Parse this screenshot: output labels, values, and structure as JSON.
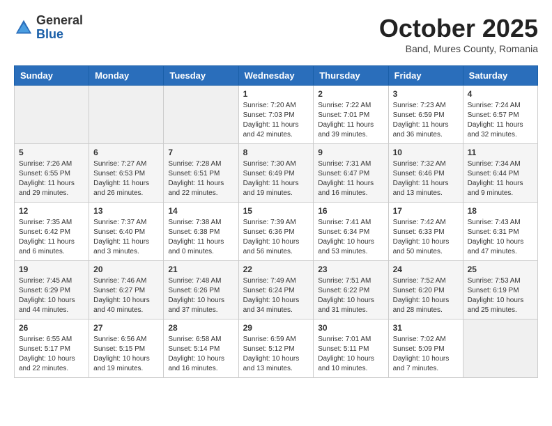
{
  "logo": {
    "general": "General",
    "blue": "Blue"
  },
  "title": "October 2025",
  "subtitle": "Band, Mures County, Romania",
  "days_of_week": [
    "Sunday",
    "Monday",
    "Tuesday",
    "Wednesday",
    "Thursday",
    "Friday",
    "Saturday"
  ],
  "weeks": [
    [
      {
        "day": "",
        "info": ""
      },
      {
        "day": "",
        "info": ""
      },
      {
        "day": "",
        "info": ""
      },
      {
        "day": "1",
        "info": "Sunrise: 7:20 AM\nSunset: 7:03 PM\nDaylight: 11 hours and 42 minutes."
      },
      {
        "day": "2",
        "info": "Sunrise: 7:22 AM\nSunset: 7:01 PM\nDaylight: 11 hours and 39 minutes."
      },
      {
        "day": "3",
        "info": "Sunrise: 7:23 AM\nSunset: 6:59 PM\nDaylight: 11 hours and 36 minutes."
      },
      {
        "day": "4",
        "info": "Sunrise: 7:24 AM\nSunset: 6:57 PM\nDaylight: 11 hours and 32 minutes."
      }
    ],
    [
      {
        "day": "5",
        "info": "Sunrise: 7:26 AM\nSunset: 6:55 PM\nDaylight: 11 hours and 29 minutes."
      },
      {
        "day": "6",
        "info": "Sunrise: 7:27 AM\nSunset: 6:53 PM\nDaylight: 11 hours and 26 minutes."
      },
      {
        "day": "7",
        "info": "Sunrise: 7:28 AM\nSunset: 6:51 PM\nDaylight: 11 hours and 22 minutes."
      },
      {
        "day": "8",
        "info": "Sunrise: 7:30 AM\nSunset: 6:49 PM\nDaylight: 11 hours and 19 minutes."
      },
      {
        "day": "9",
        "info": "Sunrise: 7:31 AM\nSunset: 6:47 PM\nDaylight: 11 hours and 16 minutes."
      },
      {
        "day": "10",
        "info": "Sunrise: 7:32 AM\nSunset: 6:46 PM\nDaylight: 11 hours and 13 minutes."
      },
      {
        "day": "11",
        "info": "Sunrise: 7:34 AM\nSunset: 6:44 PM\nDaylight: 11 hours and 9 minutes."
      }
    ],
    [
      {
        "day": "12",
        "info": "Sunrise: 7:35 AM\nSunset: 6:42 PM\nDaylight: 11 hours and 6 minutes."
      },
      {
        "day": "13",
        "info": "Sunrise: 7:37 AM\nSunset: 6:40 PM\nDaylight: 11 hours and 3 minutes."
      },
      {
        "day": "14",
        "info": "Sunrise: 7:38 AM\nSunset: 6:38 PM\nDaylight: 11 hours and 0 minutes."
      },
      {
        "day": "15",
        "info": "Sunrise: 7:39 AM\nSunset: 6:36 PM\nDaylight: 10 hours and 56 minutes."
      },
      {
        "day": "16",
        "info": "Sunrise: 7:41 AM\nSunset: 6:34 PM\nDaylight: 10 hours and 53 minutes."
      },
      {
        "day": "17",
        "info": "Sunrise: 7:42 AM\nSunset: 6:33 PM\nDaylight: 10 hours and 50 minutes."
      },
      {
        "day": "18",
        "info": "Sunrise: 7:43 AM\nSunset: 6:31 PM\nDaylight: 10 hours and 47 minutes."
      }
    ],
    [
      {
        "day": "19",
        "info": "Sunrise: 7:45 AM\nSunset: 6:29 PM\nDaylight: 10 hours and 44 minutes."
      },
      {
        "day": "20",
        "info": "Sunrise: 7:46 AM\nSunset: 6:27 PM\nDaylight: 10 hours and 40 minutes."
      },
      {
        "day": "21",
        "info": "Sunrise: 7:48 AM\nSunset: 6:26 PM\nDaylight: 10 hours and 37 minutes."
      },
      {
        "day": "22",
        "info": "Sunrise: 7:49 AM\nSunset: 6:24 PM\nDaylight: 10 hours and 34 minutes."
      },
      {
        "day": "23",
        "info": "Sunrise: 7:51 AM\nSunset: 6:22 PM\nDaylight: 10 hours and 31 minutes."
      },
      {
        "day": "24",
        "info": "Sunrise: 7:52 AM\nSunset: 6:20 PM\nDaylight: 10 hours and 28 minutes."
      },
      {
        "day": "25",
        "info": "Sunrise: 7:53 AM\nSunset: 6:19 PM\nDaylight: 10 hours and 25 minutes."
      }
    ],
    [
      {
        "day": "26",
        "info": "Sunrise: 6:55 AM\nSunset: 5:17 PM\nDaylight: 10 hours and 22 minutes."
      },
      {
        "day": "27",
        "info": "Sunrise: 6:56 AM\nSunset: 5:15 PM\nDaylight: 10 hours and 19 minutes."
      },
      {
        "day": "28",
        "info": "Sunrise: 6:58 AM\nSunset: 5:14 PM\nDaylight: 10 hours and 16 minutes."
      },
      {
        "day": "29",
        "info": "Sunrise: 6:59 AM\nSunset: 5:12 PM\nDaylight: 10 hours and 13 minutes."
      },
      {
        "day": "30",
        "info": "Sunrise: 7:01 AM\nSunset: 5:11 PM\nDaylight: 10 hours and 10 minutes."
      },
      {
        "day": "31",
        "info": "Sunrise: 7:02 AM\nSunset: 5:09 PM\nDaylight: 10 hours and 7 minutes."
      },
      {
        "day": "",
        "info": ""
      }
    ]
  ]
}
